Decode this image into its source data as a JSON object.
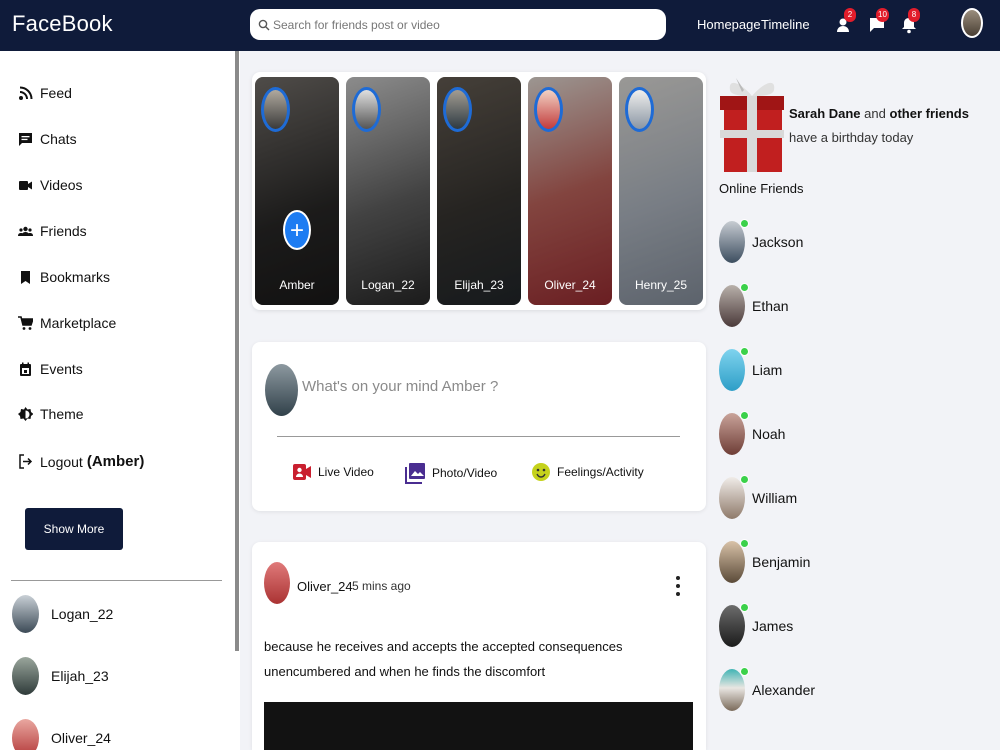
{
  "header": {
    "logo": "FaceBook",
    "search_placeholder": "Search for friends post or video",
    "nav": [
      "Homepage",
      "Timeline"
    ],
    "badges": {
      "friend_requests": "2",
      "messages": "10",
      "notifications": "8"
    }
  },
  "sidebar": {
    "items": [
      {
        "label": "Feed",
        "icon": "rss-icon"
      },
      {
        "label": "Chats",
        "icon": "chat-icon"
      },
      {
        "label": "Videos",
        "icon": "video-icon"
      },
      {
        "label": "Friends",
        "icon": "friends-icon"
      },
      {
        "label": "Bookmarks",
        "icon": "bookmark-icon"
      },
      {
        "label": "Marketplace",
        "icon": "cart-icon"
      },
      {
        "label": "Events",
        "icon": "calendar-icon"
      },
      {
        "label": "Theme",
        "icon": "theme-icon"
      }
    ],
    "logout_label": "Logout",
    "logout_user": "(Amber)",
    "show_more": "Show More",
    "friends": [
      "Logan_22",
      "Elijah_23",
      "Oliver_24"
    ]
  },
  "stories": [
    {
      "name": "Amber"
    },
    {
      "name": "Logan_22"
    },
    {
      "name": "Elijah_23"
    },
    {
      "name": "Oliver_24"
    },
    {
      "name": "Henry_25"
    }
  ],
  "composer": {
    "placeholder": "What's on your mind Amber ?",
    "actions": [
      "Live Video",
      "Photo/Video",
      "Feelings/Activity"
    ]
  },
  "post": {
    "user": "Oliver_24",
    "time": "5 mins ago",
    "text": "because he receives and accepts the accepted consequences unencumbered and when he finds the discomfort"
  },
  "right": {
    "birthday_name": "Sarah Dane",
    "birthday_and": "and",
    "birthday_others": "other friends",
    "birthday_rest": "have a birthday today",
    "online_title": "Online Friends",
    "online": [
      "Jackson",
      "Ethan",
      "Liam",
      "Noah",
      "William",
      "Benjamin",
      "James",
      "Alexander"
    ]
  },
  "colors": {
    "navy": "#0f1b3a",
    "accent": "#1d7cf2",
    "online": "#3bd14a",
    "badge": "#e21d2b"
  }
}
